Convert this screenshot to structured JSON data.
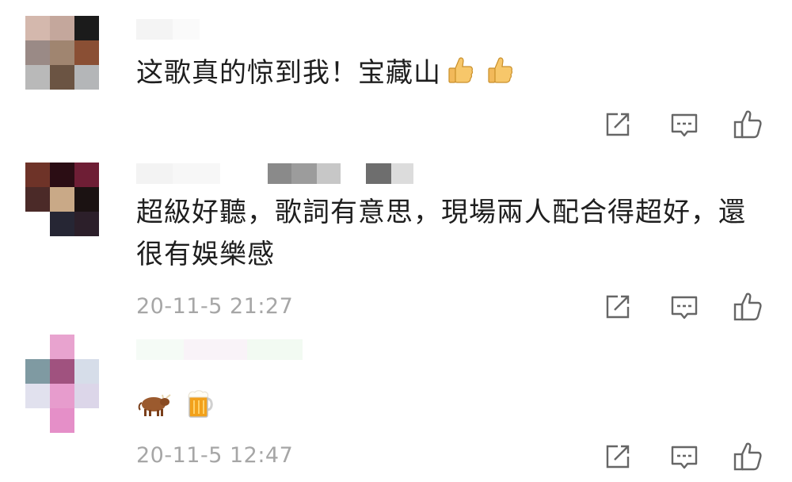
{
  "comments": [
    {
      "text": "这歌真的惊到我！宝藏山",
      "emojis": [
        "thumbs-up-icon",
        "thumbs-up-icon"
      ],
      "time": ""
    },
    {
      "text": "超級好聽，歌詞有意思，現場兩人配合得超好，還很有娛樂感",
      "emojis": [],
      "time": "20-11-5 21:27"
    },
    {
      "text": "",
      "emojis": [
        "ox-icon",
        "beer-mug-icon"
      ],
      "time": "20-11-5 12:47"
    }
  ],
  "actions": [
    "share-icon",
    "comment-icon",
    "like-icon"
  ]
}
